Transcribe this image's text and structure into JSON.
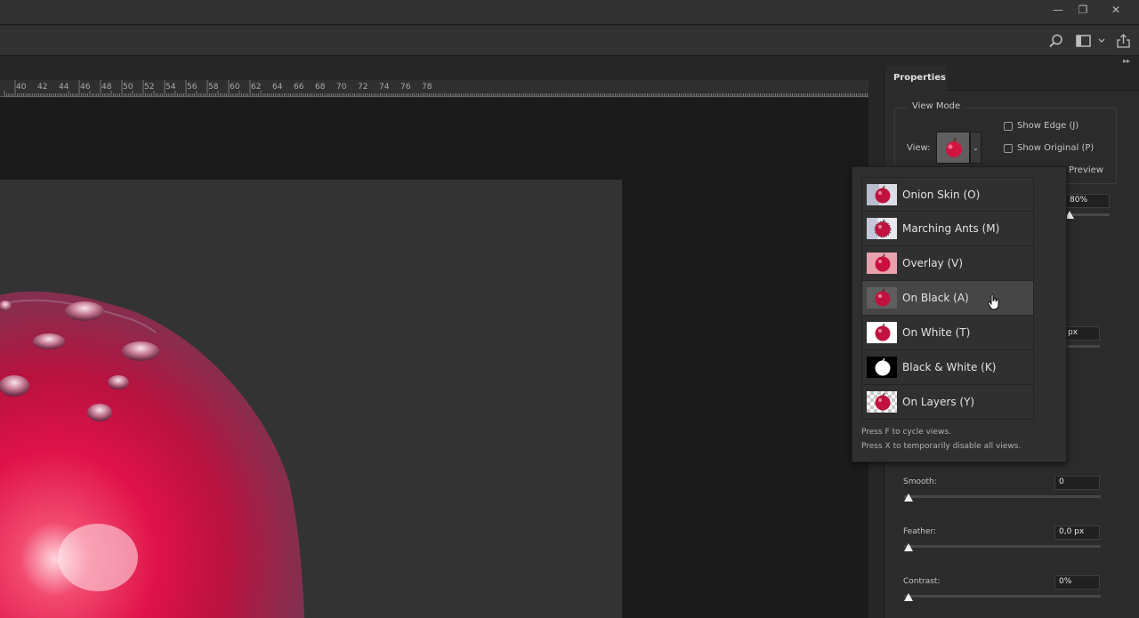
{
  "window_controls": {
    "minimize": "—",
    "restore": "❐",
    "close": "✕"
  },
  "ruler": {
    "labels": [
      "40",
      "42",
      "44",
      "46",
      "48",
      "50",
      "52",
      "54",
      "56",
      "58",
      "60",
      "62",
      "64",
      "66",
      "68",
      "70",
      "72",
      "74",
      "76",
      "78"
    ]
  },
  "panel": {
    "tab_label": "Properties",
    "view_mode": {
      "title": "View Mode",
      "view_label": "View:",
      "show_edge": "Show Edge (J)",
      "show_original": "Show Original (P)",
      "preview_label": "Preview",
      "opacity_value": "80%",
      "radius_value": "px"
    },
    "smooth": {
      "label": "Smooth:",
      "value": "0"
    },
    "feather": {
      "label": "Feather:",
      "value": "0,0 px"
    },
    "contrast": {
      "label": "Contrast:",
      "value": "0%"
    }
  },
  "view_dropdown": {
    "items": [
      {
        "label": "Onion Skin (O)",
        "thumb": "onion-skin"
      },
      {
        "label": "Marching Ants (M)",
        "thumb": "marching-ants"
      },
      {
        "label": "Overlay (V)",
        "thumb": "overlay"
      },
      {
        "label": "On Black (A)",
        "thumb": "on-black"
      },
      {
        "label": "On White (T)",
        "thumb": "on-white"
      },
      {
        "label": "Black & White (K)",
        "thumb": "black-white"
      },
      {
        "label": "On Layers (Y)",
        "thumb": "on-layers"
      }
    ],
    "hovered_index": 3,
    "hint_1": "Press F to cycle views.",
    "hint_2": "Press X to temporarily disable all views."
  },
  "colors": {
    "apple_red": "#d0123f",
    "apple_dark": "#7a1f3c"
  }
}
